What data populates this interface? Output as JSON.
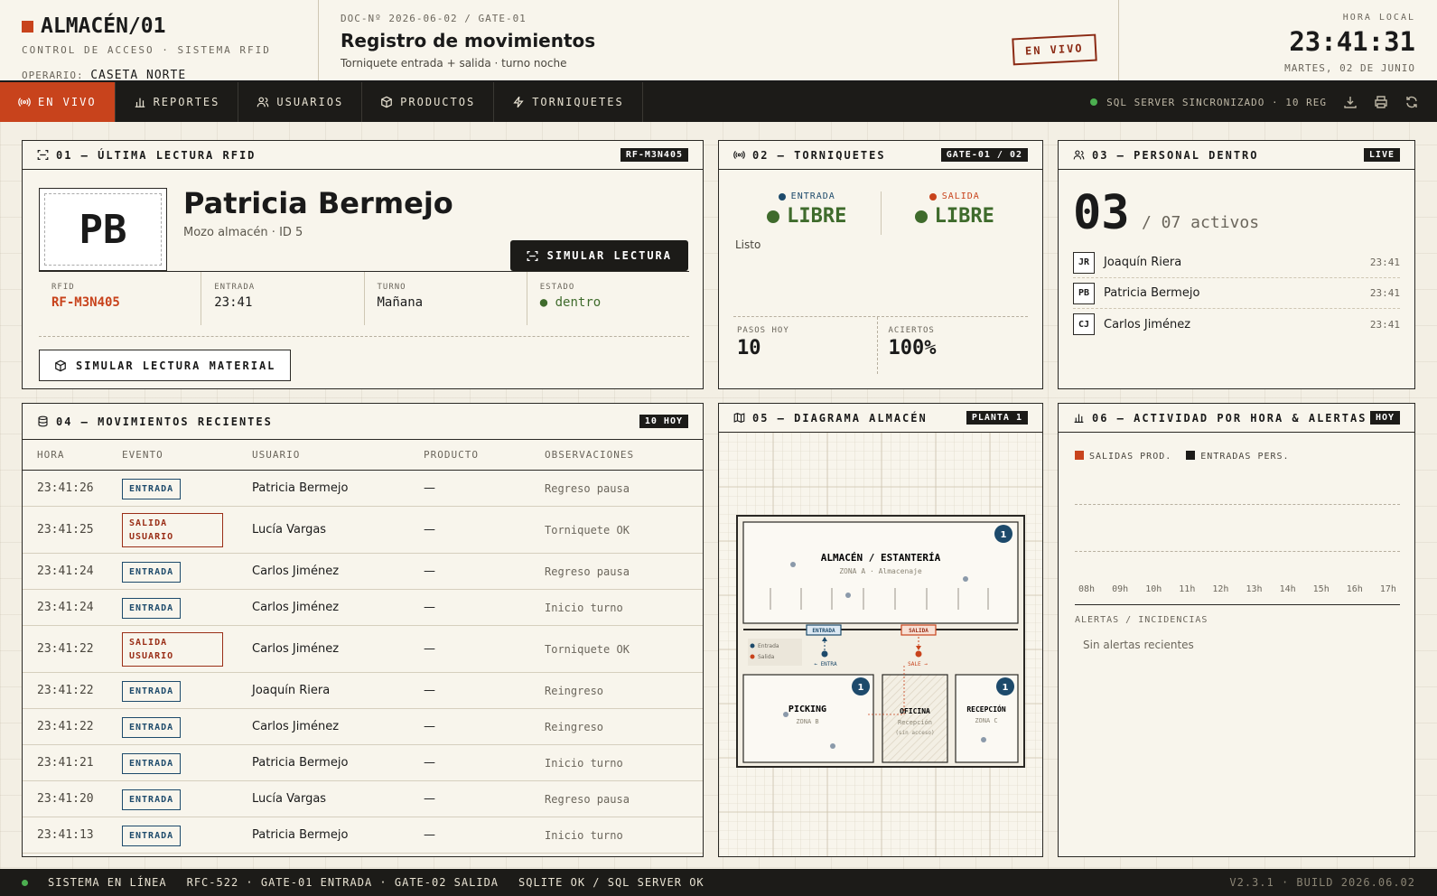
{
  "header": {
    "brand": "ALMACÉN/01",
    "subtitle": "CONTROL DE ACCESO · SISTEMA RFID",
    "operator_label": "OPERARIO:",
    "operator_value": "CASETA NORTE",
    "doc_no": "DOC-Nº 2026-06-02 / GATE-01",
    "title": "Registro de movimientos",
    "doc_sub": "Torniquete entrada + salida · turno noche",
    "stamp": "EN VIVO",
    "clock_label": "HORA LOCAL",
    "clock_time": "23:41:31",
    "clock_date": "MARTES, 02 DE JUNIO"
  },
  "nav": {
    "items": [
      {
        "label": "EN VIVO",
        "icon": "broadcast-icon"
      },
      {
        "label": "REPORTES",
        "icon": "bar-chart-icon"
      },
      {
        "label": "USUARIOS",
        "icon": "users-icon"
      },
      {
        "label": "PRODUCTOS",
        "icon": "box-icon"
      },
      {
        "label": "TORNIQUETES",
        "icon": "bolt-icon"
      }
    ],
    "sync_text": "SQL SERVER SINCRONIZADO · 10 REG"
  },
  "p1": {
    "title": "01 — ÚLTIMA LECTURA RFID",
    "tag": "RF-M3N405",
    "initials": "PB",
    "name": "Patricia Bermejo",
    "role": "Mozo almacén · ID 5",
    "sim_button": "SIMULAR LECTURA",
    "fields": [
      {
        "label": "RFID",
        "value": "RF-M3N405"
      },
      {
        "label": "ENTRADA",
        "value": "23:41"
      },
      {
        "label": "TURNO",
        "value": "Mañana"
      },
      {
        "label": "ESTADO",
        "value": "● dentro"
      }
    ],
    "material_button": "SIMULAR LECTURA MATERIAL"
  },
  "p2": {
    "title": "02 — TORNIQUETES",
    "tag": "GATE-01 / 02",
    "entrada_label": "ENTRADA",
    "entrada_value": "LIBRE",
    "salida_label": "SALIDA",
    "salida_value": "LIBRE",
    "status": "Listo",
    "pasos_label": "PASOS HOY",
    "pasos_value": "10",
    "aciertos_label": "ACIERTOS",
    "aciertos_value": "100%"
  },
  "p3": {
    "title": "03 — PERSONAL DENTRO",
    "tag": "LIVE",
    "count": "03",
    "of_text": "/ 07 activos",
    "people": [
      {
        "initials": "JR",
        "name": "Joaquín Riera",
        "time": "23:41"
      },
      {
        "initials": "PB",
        "name": "Patricia Bermejo",
        "time": "23:41"
      },
      {
        "initials": "CJ",
        "name": "Carlos Jiménez",
        "time": "23:41"
      }
    ]
  },
  "p4": {
    "title": "04 — MOVIMIENTOS RECIENTES",
    "tag": "10 HOY",
    "columns": [
      "HORA",
      "EVENTO",
      "USUARIO",
      "PRODUCTO",
      "OBSERVACIONES"
    ],
    "rows": [
      {
        "time": "23:41:26",
        "event": "ENTRADA",
        "type": "in",
        "user": "Patricia Bermejo",
        "product": "—",
        "obs": "Regreso pausa"
      },
      {
        "time": "23:41:25",
        "event": "SALIDA USUARIO",
        "type": "out",
        "user": "Lucía Vargas",
        "product": "—",
        "obs": "Torniquete OK"
      },
      {
        "time": "23:41:24",
        "event": "ENTRADA",
        "type": "in",
        "user": "Carlos Jiménez",
        "product": "—",
        "obs": "Regreso pausa"
      },
      {
        "time": "23:41:24",
        "event": "ENTRADA",
        "type": "in",
        "user": "Carlos Jiménez",
        "product": "—",
        "obs": "Inicio turno"
      },
      {
        "time": "23:41:22",
        "event": "SALIDA USUARIO",
        "type": "out",
        "user": "Carlos Jiménez",
        "product": "—",
        "obs": "Torniquete OK"
      },
      {
        "time": "23:41:22",
        "event": "ENTRADA",
        "type": "in",
        "user": "Joaquín Riera",
        "product": "—",
        "obs": "Reingreso"
      },
      {
        "time": "23:41:22",
        "event": "ENTRADA",
        "type": "in",
        "user": "Carlos Jiménez",
        "product": "—",
        "obs": "Reingreso"
      },
      {
        "time": "23:41:21",
        "event": "ENTRADA",
        "type": "in",
        "user": "Patricia Bermejo",
        "product": "—",
        "obs": "Inicio turno"
      },
      {
        "time": "23:41:20",
        "event": "ENTRADA",
        "type": "in",
        "user": "Lucía Vargas",
        "product": "—",
        "obs": "Regreso pausa"
      },
      {
        "time": "23:41:13",
        "event": "ENTRADA",
        "type": "in",
        "user": "Patricia Bermejo",
        "product": "—",
        "obs": "Inicio turno"
      }
    ]
  },
  "p5": {
    "title": "05 — DIAGRAMA ALMACÉN",
    "tag": "PLANTA 1",
    "zones": {
      "main": {
        "name": "ALMACÉN / ESTANTERÍA",
        "sub": "ZONA A · Almacenaje",
        "count": "1"
      },
      "picking": {
        "name": "PICKING",
        "sub": "ZONA B",
        "count": "1"
      },
      "oficina": {
        "name": "OFICINA",
        "sub": "Recepción",
        "note": "(sin acceso)"
      },
      "recepcion": {
        "name": "RECEPCIÓN",
        "sub": "ZONA C",
        "count": "1"
      }
    },
    "gate_in": "ENTRADA",
    "gate_out": "SALIDA",
    "arrow_in": "← ENTRA",
    "arrow_out": "SALE →",
    "legend_in": "Entrada",
    "legend_out": "Salida"
  },
  "p6": {
    "title": "06 — ACTIVIDAD POR HORA & ALERTAS",
    "tag": "HOY",
    "legend_out": "SALIDAS PROD.",
    "legend_in": "ENTRADAS PERS.",
    "hours": [
      "08h",
      "09h",
      "10h",
      "11h",
      "12h",
      "13h",
      "14h",
      "15h",
      "16h",
      "17h"
    ],
    "alerts_label": "ALERTAS / INCIDENCIAS",
    "alerts_empty": "Sin alertas recientes"
  },
  "footer": {
    "status": "SISTEMA EN LÍNEA",
    "gates": "RFC-522 · GATE-01 ENTRADA · GATE-02 SALIDA",
    "db": "SQLITE OK / SQL SERVER OK",
    "version": "V2.3.1 · BUILD 2026.06.02"
  },
  "colors": {
    "accent": "#c8431c",
    "dark": "#1c1b18",
    "entrada": "#1d4a6b",
    "salida": "#9a2e17",
    "ok": "#3f6b2c"
  }
}
